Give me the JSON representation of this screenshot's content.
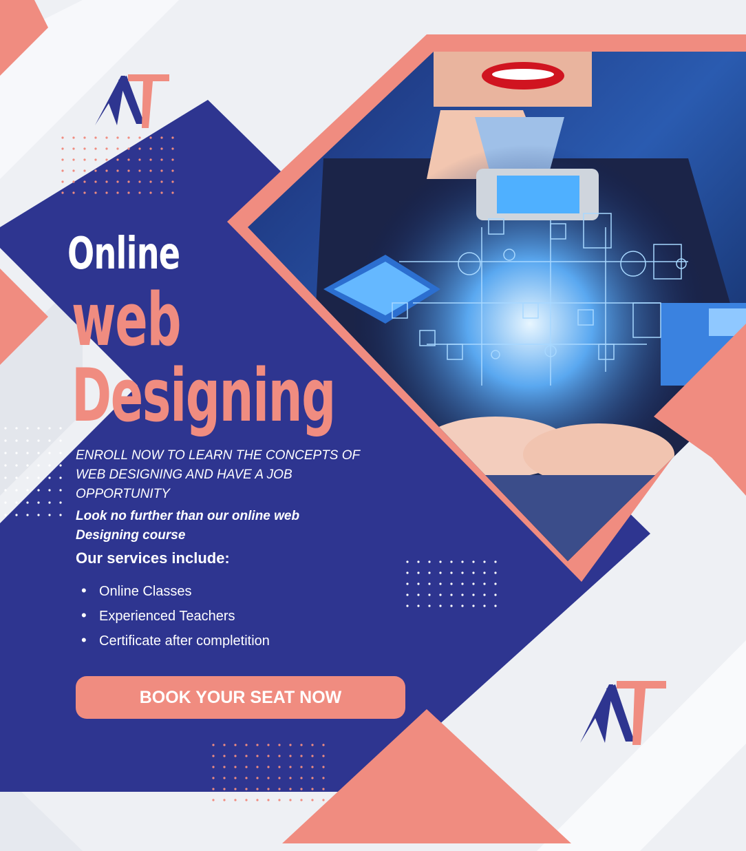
{
  "headline": {
    "line1": "Online",
    "line2": "web",
    "line3": "Designing"
  },
  "enroll_text": "ENROLL NOW TO LEARN THE CONCEPTS OF WEB DESIGNING AND HAVE A JOB OPPORTUNITY",
  "tagline": "Look no further than our online web Designing course",
  "services": {
    "title": "Our services include:",
    "items": [
      "Online Classes",
      "Experienced Teachers",
      "Certificate after completition"
    ]
  },
  "cta": {
    "label": "BOOK YOUR SEAT NOW"
  },
  "logo": {
    "text": "AT"
  },
  "colors": {
    "navy": "#2e3590",
    "coral": "#f08c80",
    "background": "#eef0f4"
  },
  "icons": [
    "logo-at-icon",
    "world-map-network-icon",
    "smartphone-icon",
    "tablet-icon",
    "laptop-icon"
  ]
}
